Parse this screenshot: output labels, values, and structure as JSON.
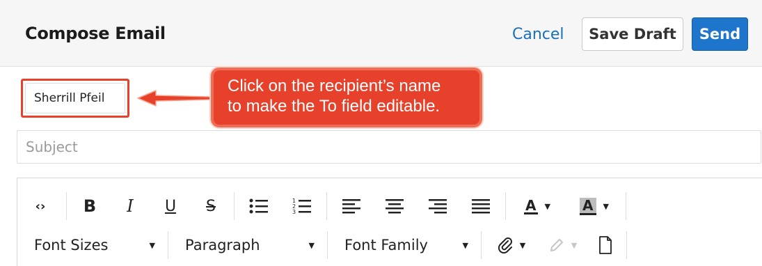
{
  "header": {
    "title": "Compose Email",
    "cancel_label": "Cancel",
    "save_draft_label": "Save Draft",
    "send_label": "Send"
  },
  "recipient": {
    "name": "Sherrill Pfeil"
  },
  "callout": {
    "text": "Click on the recipient’s name\nto make the To field editable."
  },
  "subject": {
    "placeholder": "Subject",
    "value": ""
  },
  "toolbar": {
    "row1": [
      "source-code",
      "bold",
      "italic",
      "underline",
      "strikethrough",
      "bulleted-list",
      "numbered-list",
      "align-left",
      "align-center",
      "align-right",
      "justify",
      "text-color",
      "background-color"
    ],
    "font_sizes_label": "Font Sizes",
    "paragraph_label": "Paragraph",
    "font_family_label": "Font Family",
    "row2_icons": [
      "paperclip-icon",
      "pencil-icon",
      "document-icon"
    ]
  },
  "colors": {
    "header_bg": "#f6f6f6",
    "primary_blue": "#1d75cc",
    "link_blue": "#1a6fba",
    "annotation_red": "#e8412b"
  }
}
